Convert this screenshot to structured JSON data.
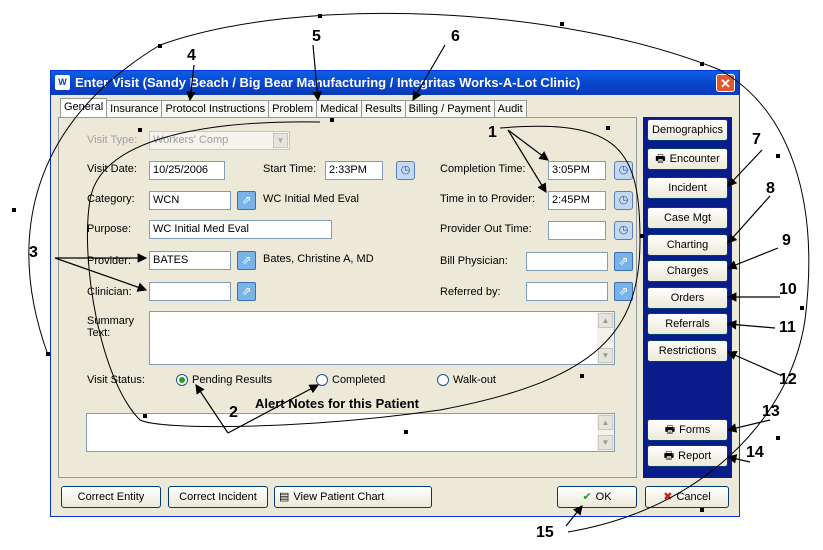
{
  "window": {
    "title": "Enter Visit (Sandy Beach / Big Bear Manufacturing / Integritas Works-A-Lot Clinic)",
    "close_glyph": "✕",
    "app_icon": "W"
  },
  "tabs": [
    "General",
    "Insurance",
    "Protocol Instructions",
    "Problem",
    "Medical",
    "Results",
    "Billing / Payment",
    "Audit"
  ],
  "form": {
    "visit_type_label": "Visit Type:",
    "visit_type_value": "Workers' Comp",
    "visit_date_label": "Visit Date:",
    "visit_date_value": "10/25/2006",
    "start_time_label": "Start Time:",
    "start_time_value": "2:33PM",
    "category_label": "Category:",
    "category_value": "WCN",
    "category_desc": "WC  Initial Med Eval",
    "purpose_label": "Purpose:",
    "purpose_value": "WC  Initial Med Eval",
    "provider_label": "Provider:",
    "provider_value": "BATES",
    "provider_desc": "Bates, Christine A, MD",
    "clinician_label": "Clinician:",
    "clinician_value": "",
    "summary_label": "Summary Text:",
    "completion_time_label": "Completion Time:",
    "completion_time_value": "3:05PM",
    "time_in_provider_label": "Time in to Provider:",
    "time_in_provider_value": "2:45PM",
    "provider_out_label": "Provider Out Time:",
    "provider_out_value": "",
    "bill_physician_label": "Bill Physician:",
    "bill_physician_value": "",
    "referred_by_label": "Referred by:",
    "referred_by_value": "",
    "visit_status_label": "Visit Status:",
    "status_options": [
      "Pending Results",
      "Completed",
      "Walk-out"
    ],
    "status_selected": "Pending Results",
    "alert_notes_label": "Alert Notes for this Patient"
  },
  "sidebar": {
    "demographics": "Demographics",
    "encounter": "Encounter",
    "incident": "Incident",
    "case_mgt": "Case Mgt",
    "charting": "Charting",
    "charges": "Charges",
    "orders": "Orders",
    "referrals": "Referrals",
    "restrictions": "Restrictions",
    "forms": "Forms",
    "report": "Report"
  },
  "footer": {
    "correct_entity": "Correct Entity",
    "correct_incident": "Correct Incident",
    "view_chart": "View Patient Chart",
    "ok": "OK",
    "cancel": "Cancel"
  },
  "callouts": [
    "1",
    "2",
    "3",
    "4",
    "5",
    "6",
    "7",
    "8",
    "9",
    "10",
    "11",
    "12",
    "13",
    "14",
    "15"
  ],
  "glyphs": {
    "dropdown": "▼",
    "scroll_up": "▲",
    "scroll_down": "▼",
    "picker": "⇗",
    "clock": "◷",
    "printer": "🖶",
    "check": "✔",
    "cross": "✖",
    "chart": "▤"
  }
}
